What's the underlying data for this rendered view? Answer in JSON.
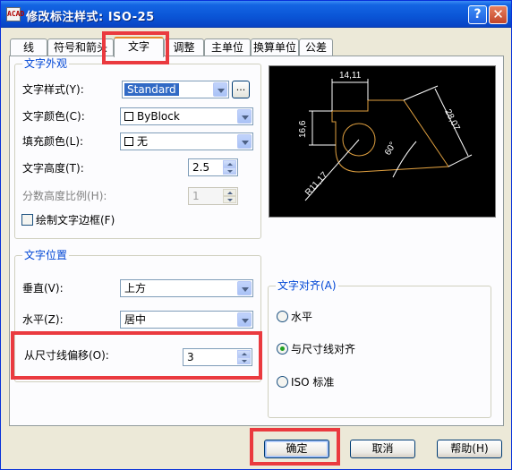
{
  "window": {
    "icon_text": "ACAD",
    "title": "修改标注样式: ISO-25",
    "help_button": "?",
    "close_button": "✕"
  },
  "tabs": [
    "线",
    "符号和箭头",
    "文字",
    "调整",
    "主单位",
    "换算单位",
    "公差"
  ],
  "active_tab": "文字",
  "text_appearance": {
    "legend": "文字外观",
    "style_label": "文字样式(Y):",
    "style_value": "Standard",
    "style_button": "...",
    "color_label": "文字颜色(C):",
    "color_value": "ByBlock",
    "fill_label": "填充颜色(L):",
    "fill_value": "无",
    "height_label": "文字高度(T):",
    "height_value": "2.5",
    "fraction_label": "分数高度比例(H):",
    "fraction_value": "1",
    "frame_label": "绘制文字边框(F)"
  },
  "text_placement": {
    "legend": "文字位置",
    "vertical_label": "垂直(V):",
    "vertical_value": "上方",
    "horizontal_label": "水平(Z):",
    "horizontal_value": "居中",
    "offset_label": "从尺寸线偏移(O):",
    "offset_value": "3"
  },
  "text_alignment": {
    "legend": "文字对齐(A)",
    "options": [
      "水平",
      "与尺寸线对齐",
      "ISO 标准"
    ],
    "selected": "与尺寸线对齐"
  },
  "preview": {
    "dim_top": "14,11",
    "dim_left": "16,6",
    "dim_right": "28,07",
    "angle": "60°",
    "radius": "R11,17",
    "colors": {
      "background": "#000000",
      "geometry": "#e0a040",
      "dimension": "#ffffff"
    }
  },
  "buttons": {
    "ok": "确定",
    "cancel": "取消",
    "help": "帮助(H)"
  },
  "highlight_color": "#ea3a3f"
}
